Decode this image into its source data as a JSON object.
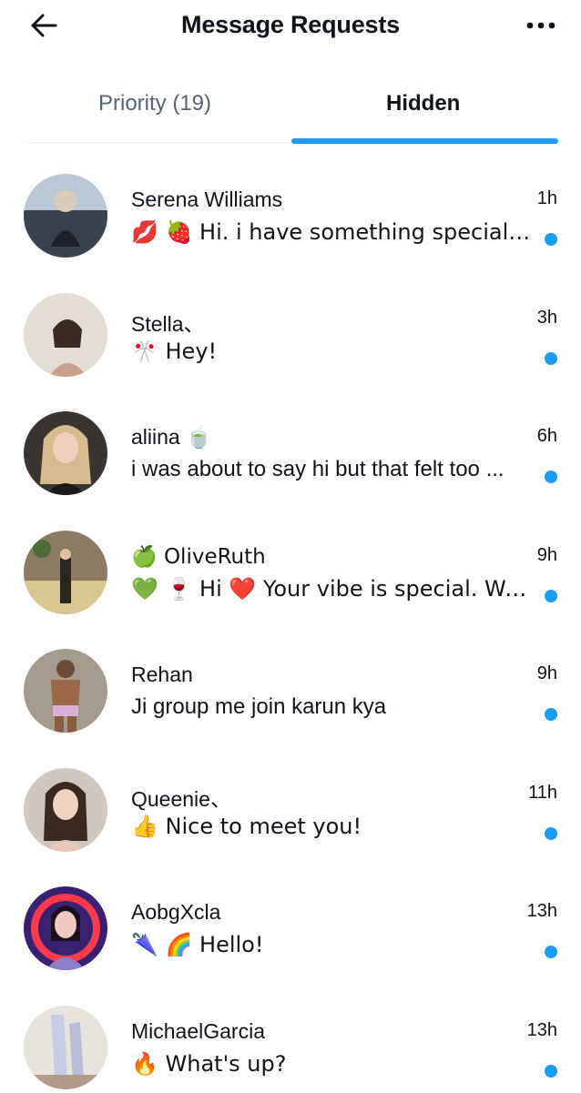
{
  "header": {
    "title": "Message Requests"
  },
  "tabs": [
    {
      "label": "Priority (19)"
    },
    {
      "label": "Hidden"
    }
  ],
  "colors": {
    "accent": "#1d9bf0",
    "text": "#0f1419",
    "muted": "#536471"
  },
  "icons": {
    "back": "arrow-left-icon",
    "more": "more-dots-icon"
  },
  "messages": [
    {
      "name": "Serena Williams",
      "time": "1h",
      "snippet": "💋 🍓 Hi. i have something special... j..."
    },
    {
      "name": "Stella、",
      "time": "3h",
      "snippet": "🎌 Hey!"
    },
    {
      "name": "aliina 🍵",
      "time": "6h",
      "snippet": "i was about to say hi but that felt too ..."
    },
    {
      "name": "🍏 OliveRuth",
      "time": "9h",
      "snippet": "💚 🍷 Hi ❤️ Your vibe is special. Want..."
    },
    {
      "name": "Rehan",
      "time": "9h",
      "snippet": "Ji group me join karun kya"
    },
    {
      "name": "Queenie、",
      "time": "11h",
      "snippet": "👍 Nice to meet you!"
    },
    {
      "name": "AobgXcla",
      "time": "13h",
      "snippet": "🌂 🌈 Hello!"
    },
    {
      "name": "MichaelGarcia",
      "time": "13h",
      "snippet": "🔥 What's up?"
    }
  ]
}
